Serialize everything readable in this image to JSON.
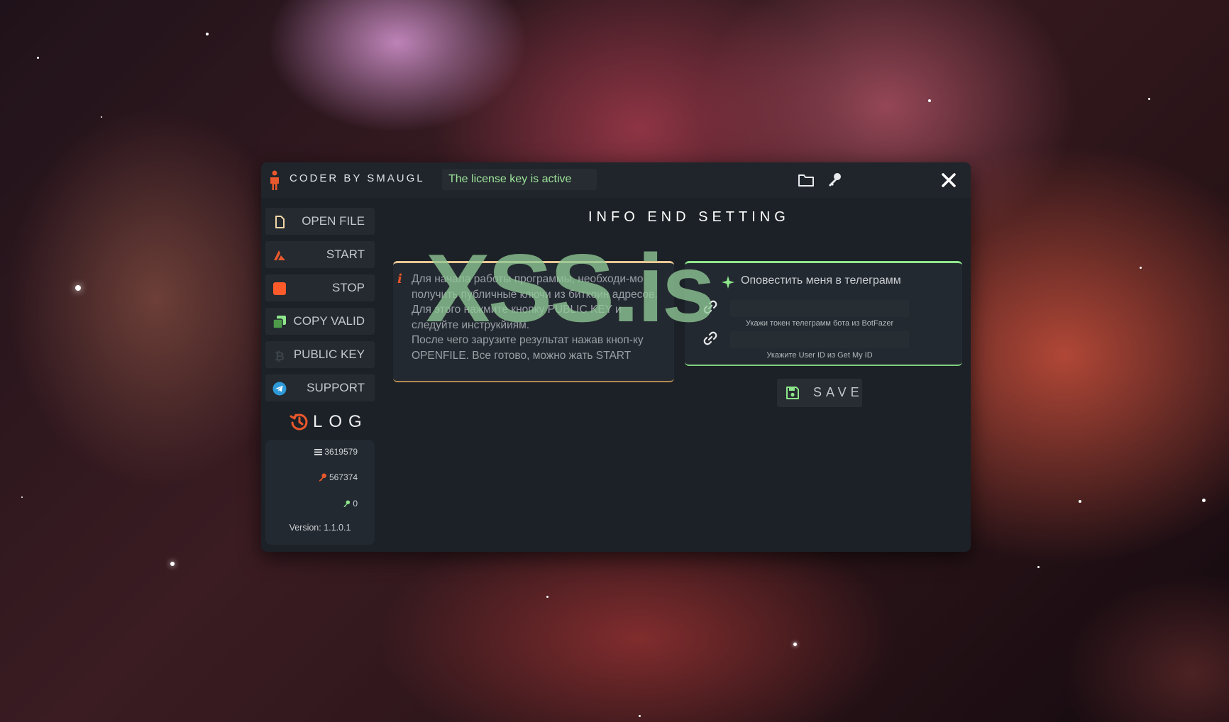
{
  "titlebar": {
    "title": "CODER BY SMAUGL",
    "license_status": "The license key is active",
    "icons": [
      "person-icon",
      "folder-icon",
      "key-icon",
      "close-icon"
    ]
  },
  "sidebar": {
    "items": [
      {
        "label": "OPEN FILE",
        "icon": "file-icon",
        "color": "#f2d6a7"
      },
      {
        "label": "START",
        "icon": "start-icon",
        "color": "#e9582c"
      },
      {
        "label": "STOP",
        "icon": "stop-icon",
        "color": "#ff5a2a"
      },
      {
        "label": "COPY VALID",
        "icon": "copy-icon",
        "color": "#8ee68b"
      },
      {
        "label": "PUBLIC KEY",
        "icon": "bitcoin-icon",
        "color": "#3c434a"
      },
      {
        "label": "SUPPORT",
        "icon": "telegram-icon",
        "color": "#2f9ad8"
      }
    ]
  },
  "log": {
    "title": "LOG",
    "lines_count": "3619579",
    "keys_count": "567374",
    "found_count": "0",
    "version": "Version: 1.1.0.1"
  },
  "main": {
    "title": "INFO END SETTING",
    "info": {
      "lines": [
        " Для начала работы программы, необходи-мо получить публичные ключи из биткоин адресов.",
        "Для этого нажмите кнопку PUBLIC KEY  и следуйте инструкйиям.",
        "После чего зарузите результат нажав кноп-ку OPENFILE. Все готово, можно жать START"
      ]
    },
    "telegram": {
      "label": "Оповестить меня в телеграмм",
      "token_value": "",
      "token_hint": "Укажи токен телеграмм бота из BotFazer",
      "userid_value": "",
      "userid_hint": "Укажите User ID из Get My ID"
    },
    "save_label": "SAVE"
  },
  "watermark": "XSS.is",
  "colors": {
    "accent_orange": "#e9582c",
    "accent_green": "#8ee68b",
    "accent_gold": "#e8c794",
    "window_bg": "#1c2127",
    "panel_bg": "#232930"
  }
}
